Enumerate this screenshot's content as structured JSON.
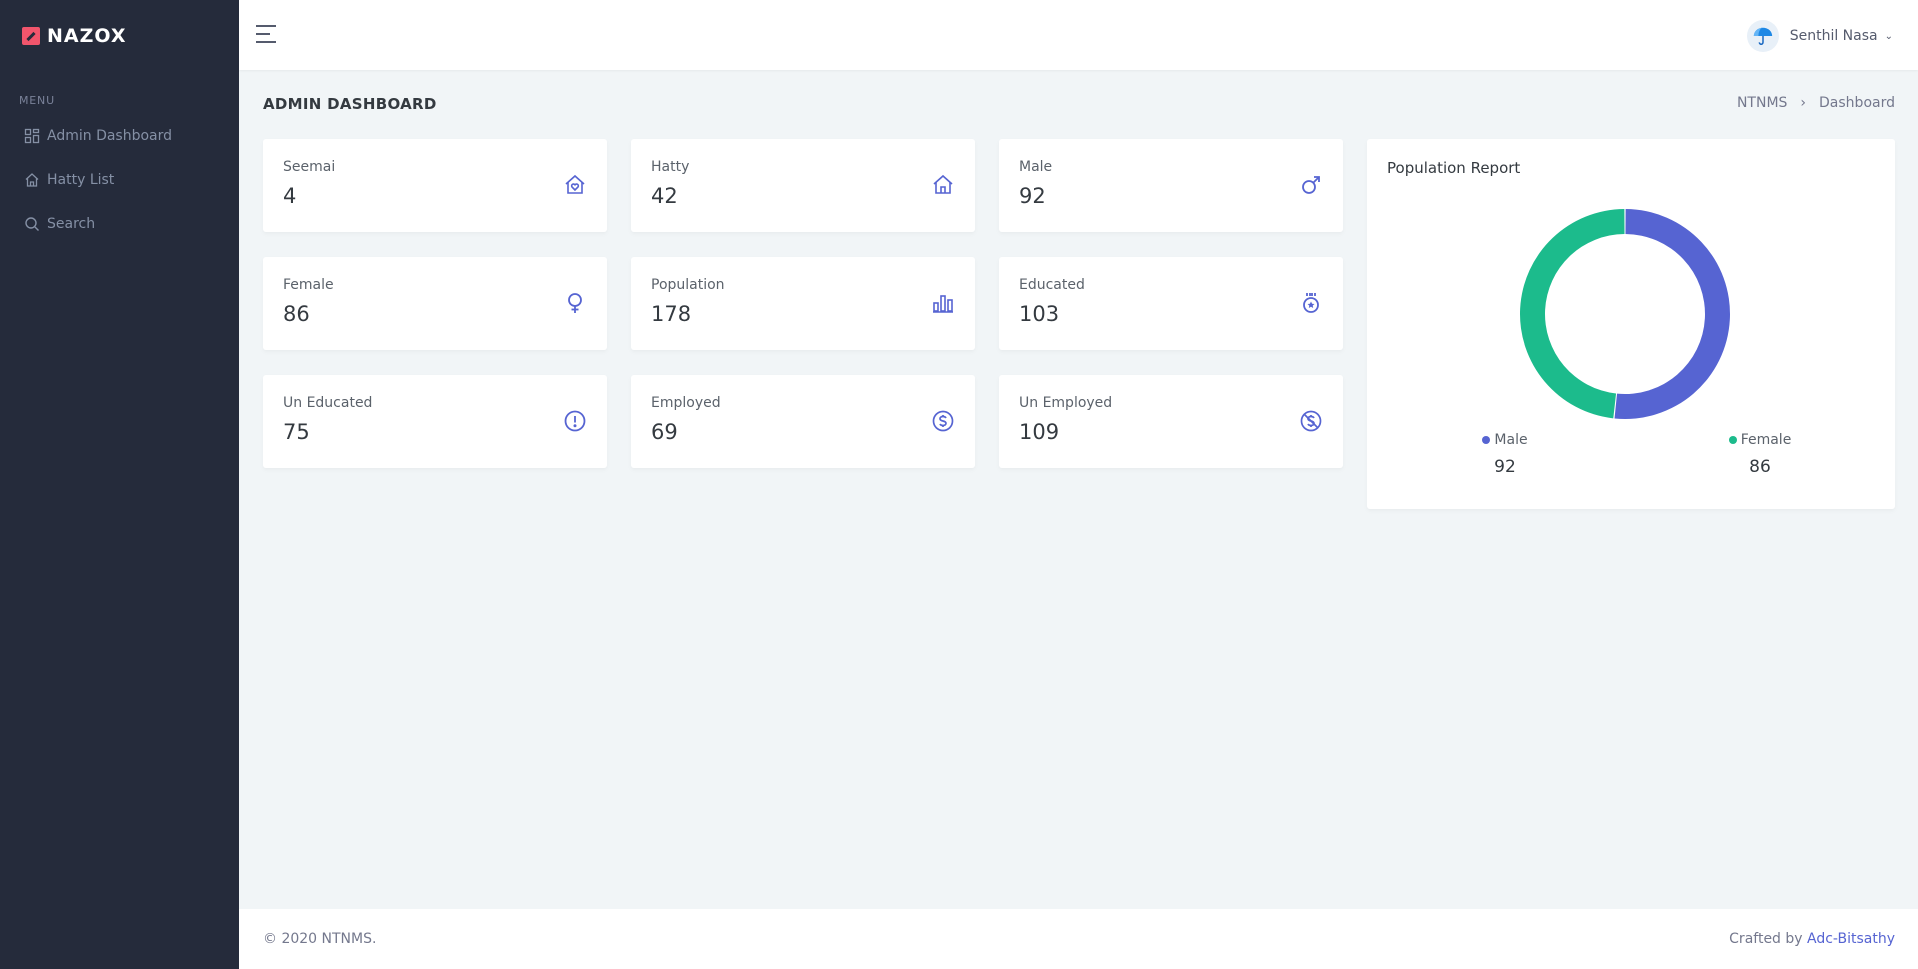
{
  "brand": {
    "name": "NAZOX"
  },
  "sidebar": {
    "menu_title": "MENU",
    "items": [
      {
        "label": "Admin Dashboard",
        "icon": "dashboard-icon"
      },
      {
        "label": "Hatty List",
        "icon": "home-icon"
      },
      {
        "label": "Search",
        "icon": "search-icon"
      }
    ]
  },
  "topbar": {
    "user_name": "Senthil Nasa"
  },
  "page": {
    "title": "ADMIN DASHBOARD",
    "breadcrumb": [
      "NTNMS",
      "Dashboard"
    ]
  },
  "stats": [
    {
      "label": "Seemai",
      "value": "4",
      "icon": "home-heart-icon"
    },
    {
      "label": "Hatty",
      "value": "42",
      "icon": "home-icon"
    },
    {
      "label": "Male",
      "value": "92",
      "icon": "male-icon"
    },
    {
      "label": "Female",
      "value": "86",
      "icon": "female-icon"
    },
    {
      "label": "Population",
      "value": "178",
      "icon": "bar-chart-icon"
    },
    {
      "label": "Educated",
      "value": "103",
      "icon": "medal-icon"
    },
    {
      "label": "Un Educated",
      "value": "75",
      "icon": "alert-circle-icon"
    },
    {
      "label": "Employed",
      "value": "69",
      "icon": "money-circle-icon"
    },
    {
      "label": "Un Employed",
      "value": "109",
      "icon": "money-off-circle-icon"
    }
  ],
  "chart": {
    "title": "Population Report"
  },
  "chart_data": {
    "type": "pie",
    "title": "Population Report",
    "categories": [
      "Male",
      "Female"
    ],
    "values": [
      92,
      86
    ],
    "colors": [
      "#5664d2",
      "#1cbb8c"
    ],
    "donut": true
  },
  "footer": {
    "copyright": "© 2020 NTNMS.",
    "crafted_prefix": "Crafted by",
    "crafted_link": "Adc-Bitsathy"
  },
  "colors": {
    "accent": "#5664d2",
    "sidebar": "#252b3b",
    "brand": "#f1556c",
    "success": "#1cbb8c"
  }
}
